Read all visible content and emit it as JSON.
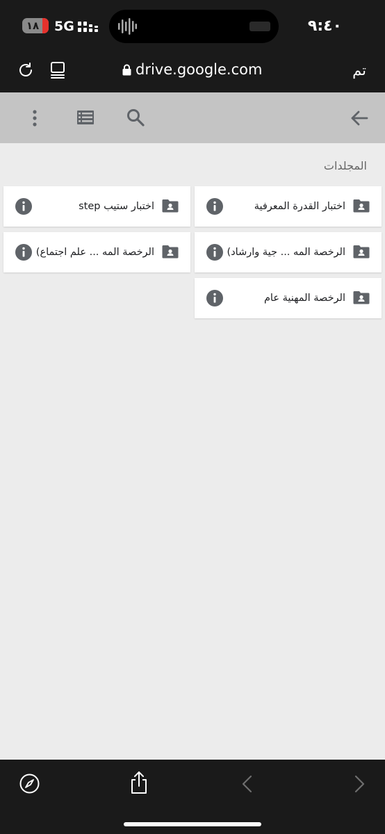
{
  "status_bar": {
    "time": "٩:٤٠",
    "battery_level": "١٨",
    "network": "5G"
  },
  "browser": {
    "url": "drive.google.com",
    "done_label": "تم"
  },
  "drive": {
    "section_title": "المجلدات",
    "folders": [
      {
        "name": "اختبار القدرة المعرفية"
      },
      {
        "name": "اختبار ستيب step"
      },
      {
        "name": "الرخصة المه ... جية وارشاد)"
      },
      {
        "name": "الرخصة المه ... علم اجتماع)"
      },
      {
        "name": "الرخصة المهنية عام"
      }
    ]
  },
  "colors": {
    "browser_chrome": "#1a1a1a",
    "toolbar": "#c4c4c4",
    "background": "#ececec",
    "icon_gray": "#5f6368",
    "battery_low": "#e5322d"
  },
  "icons": [
    "reload-icon",
    "tabs-icon",
    "lock-icon",
    "more-icon",
    "list-view-icon",
    "search-icon",
    "back-arrow-icon",
    "shared-folder-icon",
    "info-icon",
    "compass-icon",
    "share-icon",
    "chevron-left-icon",
    "chevron-right-icon"
  ]
}
